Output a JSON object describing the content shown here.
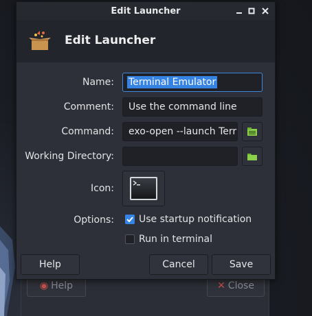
{
  "window": {
    "title": "Edit Launcher"
  },
  "header": {
    "title": "Edit Launcher",
    "icon": "launcher-package-icon"
  },
  "form": {
    "name_label": "Name:",
    "name_value": "Terminal Emulator",
    "comment_label": "Comment:",
    "comment_value": "Use the command line",
    "command_label": "Command:",
    "command_value": "exo-open --launch Terr",
    "workdir_label": "Working Directory:",
    "workdir_value": "",
    "icon_label": "Icon:",
    "icon_name": "terminal-icon",
    "options_label": "Options:",
    "startup_notification_label": "Use startup notification",
    "startup_notification_checked": true,
    "run_in_terminal_label": "Run in terminal",
    "run_in_terminal_checked": false
  },
  "buttons": {
    "help": "Help",
    "cancel": "Cancel",
    "save": "Save"
  },
  "background_window": {
    "help": "Help",
    "close": "Close"
  },
  "colors": {
    "accent": "#3584e4",
    "folder": "#8bd04a"
  }
}
